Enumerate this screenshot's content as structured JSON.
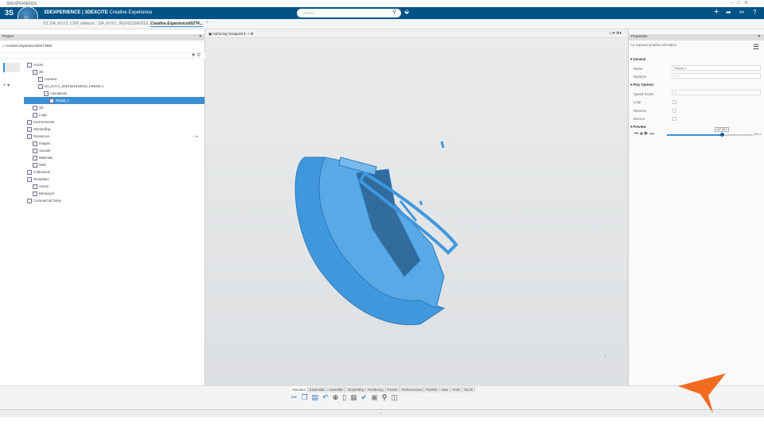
{
  "window": {
    "title": "3DEXPERIENCE"
  },
  "header": {
    "brand_bold": "3DEXPERIENCE | 3DEXCITE",
    "brand_rest": " Creative Experience",
    "search_placeholder": "Search",
    "compass_label": "V.R"
  },
  "tabs": [
    {
      "label": "V3_DA_KVY1_CXP_wRecor... DA_KVY1_001F5216A0010..."
    },
    {
      "label": "Creative Experience00274..."
    }
  ],
  "viewport_toolbar": {
    "viewpoint": "Authoring Viewpoint"
  },
  "project": {
    "panel_title": "Project",
    "root": "Creative Experience00274380",
    "tree": [
      {
        "label": "Actors",
        "depth": 0
      },
      {
        "label": "3D",
        "depth": 1
      },
      {
        "label": "Camera",
        "depth": 2
      },
      {
        "label": "DA_KVY1_001F5216A0010_KIN000.A",
        "depth": 2
      },
      {
        "label": "Animations",
        "depth": 3
      },
      {
        "label": "Replay 1",
        "depth": 4,
        "selected": true
      },
      {
        "label": "2D",
        "depth": 1
      },
      {
        "label": "Logic",
        "depth": 1
      },
      {
        "label": "Environments",
        "depth": 0
      },
      {
        "label": "Storytelling",
        "depth": 0
      },
      {
        "label": "Resources",
        "depth": 0
      },
      {
        "label": "Images",
        "depth": 1
      },
      {
        "label": "Sounds",
        "depth": 1
      },
      {
        "label": "Materials",
        "depth": 1
      },
      {
        "label": "Web",
        "depth": 1
      },
      {
        "label": "Collections",
        "depth": 0
      },
      {
        "label": "Templates",
        "depth": 0
      },
      {
        "label": "Actors",
        "depth": 1
      },
      {
        "label": "Behaviors",
        "depth": 1
      },
      {
        "label": "Commercial Twins",
        "depth": 0
      }
    ]
  },
  "properties": {
    "panel_title": "Properties",
    "description": "An exposed product animation",
    "general": "General",
    "name_label": "Name",
    "name_value": "Replay 1",
    "duration_label": "Duration",
    "duration_value": "230",
    "play_options": "Play Options",
    "speed_label": "Speed Factor",
    "speed_value": "1",
    "loop": "Loop",
    "reverse": "Reverse",
    "bounce": "Bounce",
    "preview": "Preview",
    "time_value": "147.49 s",
    "end_value": "230 s",
    "progress": 0.64
  },
  "bottom_tabs": [
    "Standard",
    "Essentials",
    "Assemble",
    "Storytelling",
    "Rendering",
    "Panels",
    "Performances",
    "Publish",
    "View",
    "Tools",
    "Touch"
  ],
  "colors": {
    "header": "#005386",
    "selection": "#3d8fd1",
    "model": "#2f8fdc",
    "logo": "#f26b21"
  }
}
